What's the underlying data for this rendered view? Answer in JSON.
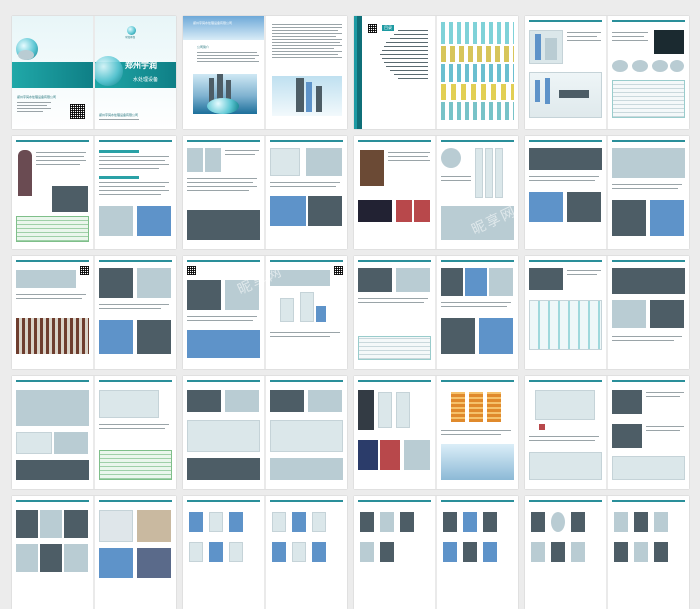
{
  "cover": {
    "brand": "郑州宇润",
    "subtitle": "水处理设备",
    "logo_label": "宇润环保",
    "company_line": "郑州宇润水处理设备有限公司",
    "back_line": "郑州宇润水处理设备有限公司"
  },
  "intro": {
    "banner": "郑州宇润水处理设备有限公司",
    "heading": "公司简介"
  },
  "toc": {
    "tag": "目录"
  },
  "colors": {
    "accent": "#1e9aa3",
    "page": "#ffffff",
    "background": "#ececec"
  },
  "watermark": "昵享网"
}
